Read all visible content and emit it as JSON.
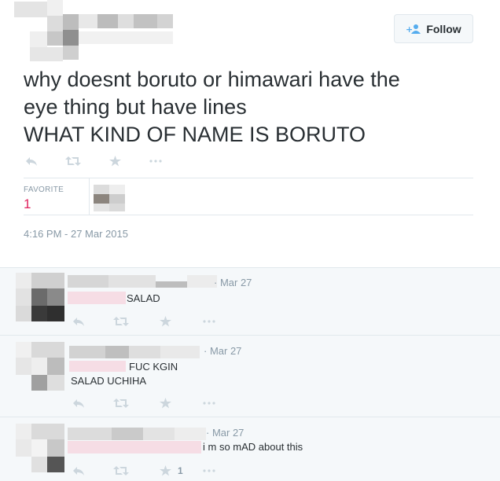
{
  "header": {
    "follow_label": "Follow",
    "follow_icon": "add-user-icon"
  },
  "tweet": {
    "text": "why doesnt boruto or himawari have the\neye thing but have lines\nWHAT KIND OF NAME IS BORUTO",
    "favorite_label": "FAVORITE",
    "favorite_count": "1",
    "timestamp": "4:16 PM - 27 Mar 2015"
  },
  "replies": [
    {
      "date": "· Mar 27",
      "text": "SALAD",
      "favorites": ""
    },
    {
      "date": "· Mar 27",
      "text": "FUC KGIN\nSALAD UCHIHA",
      "favorites": ""
    },
    {
      "date": "· Mar 27",
      "text": "i m so mAD about this",
      "favorites": "1"
    }
  ],
  "icons": [
    "reply-icon",
    "retweet-icon",
    "favorite-star-icon",
    "more-icon"
  ],
  "colors": {
    "accent": "#55acee",
    "favorite": "#e0245e",
    "muted": "#8899a6",
    "reply_bg": "#f5f8fa"
  }
}
